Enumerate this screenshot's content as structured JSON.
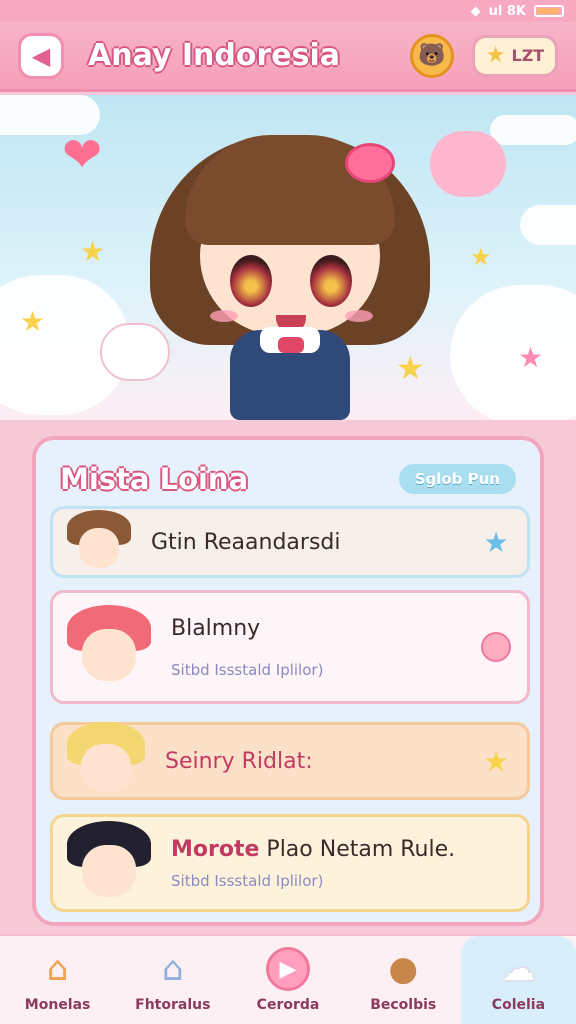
{
  "status": {
    "signal": "ul 8K"
  },
  "header": {
    "title": "Anay Indoresia",
    "level_label": "LZT"
  },
  "panel": {
    "title": "Mista Loina",
    "filter_label": "Sglob Pun",
    "items": [
      {
        "title": "Gtin Reaandarsdi",
        "subtitle": ""
      },
      {
        "title": "Blalmny",
        "subtitle": "Sitbd Issstald Iplilor)"
      },
      {
        "title": "Seinry Ridlat:",
        "subtitle": ""
      },
      {
        "title_bold": "Morote",
        "title_rest": "Plao Netam Rule.",
        "subtitle": "Sitbd Issstald Iplilor)"
      }
    ]
  },
  "nav": [
    {
      "label": "Monelas",
      "icon": "house-icon"
    },
    {
      "label": "Fhtoralus",
      "icon": "house-outline-icon"
    },
    {
      "label": "Cerorda",
      "icon": "play-icon"
    },
    {
      "label": "Becolbis",
      "icon": "bear-icon"
    },
    {
      "label": "Colelia",
      "icon": "cloud-icon"
    }
  ],
  "colors": {
    "accent": "#f59fb9",
    "brand_text": "#d9577f",
    "panel_bg": "#e6f1fb"
  }
}
